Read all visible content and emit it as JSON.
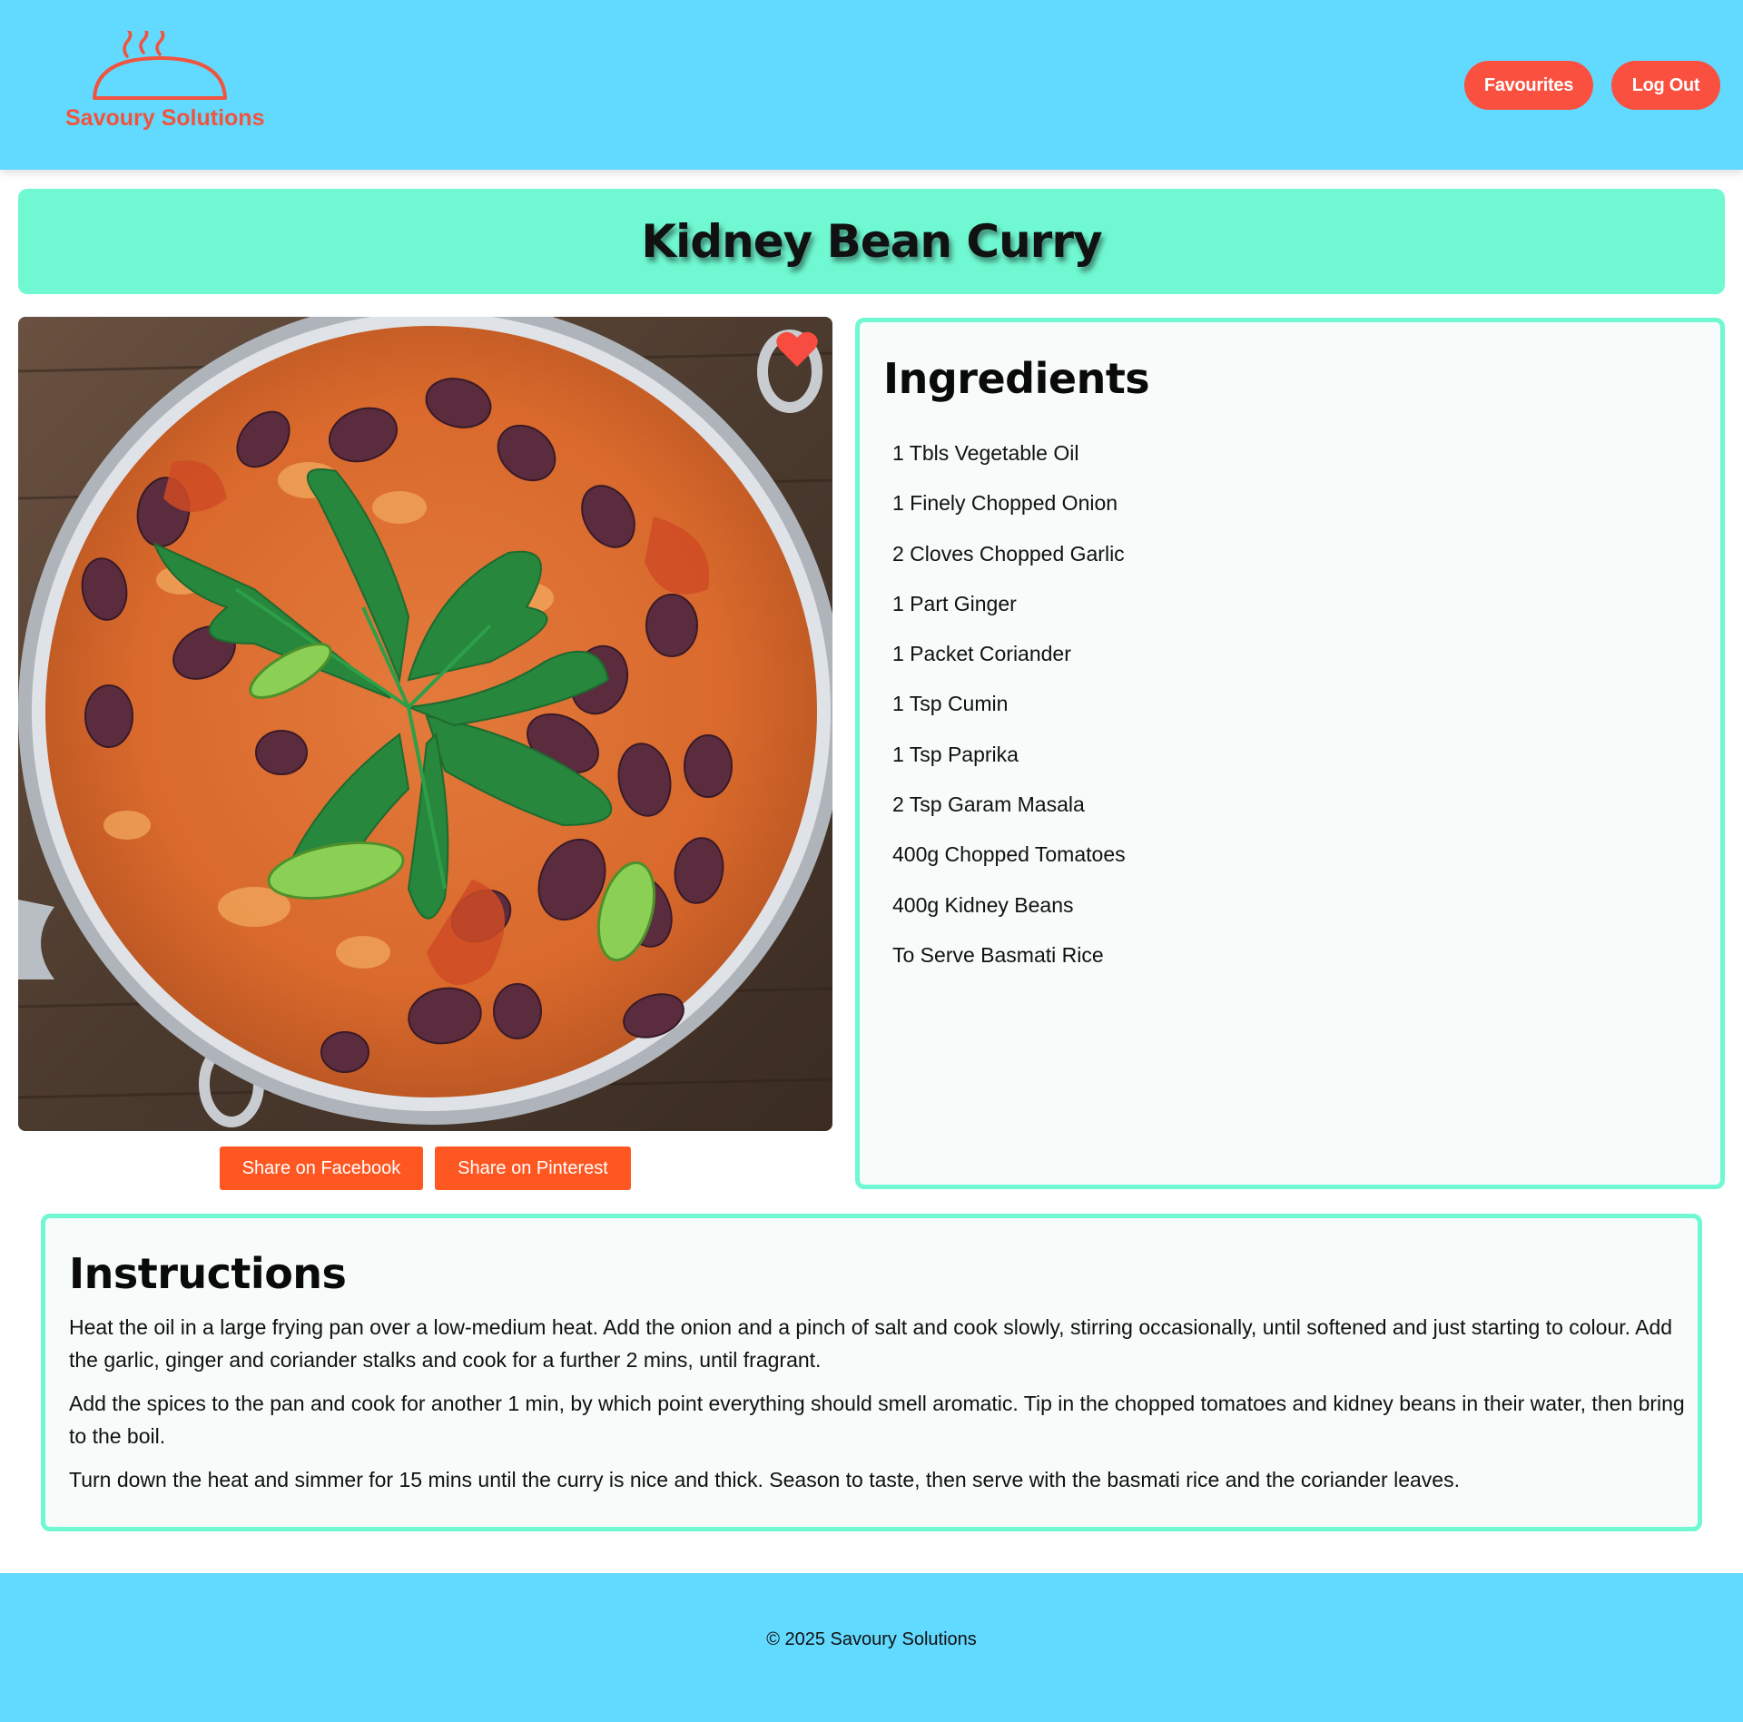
{
  "header": {
    "logo_text": "Savoury Solutions",
    "logo_icon": "serving-cloche-icon",
    "favourites_label": "Favourites",
    "logout_label": "Log Out"
  },
  "recipe": {
    "title": "Kidney Bean Curry",
    "image_alt": "Kidney Bean Curry",
    "favourite_icon": "heart-icon",
    "favourited": true
  },
  "share": {
    "facebook_label": "Share on Facebook",
    "pinterest_label": "Share on Pinterest"
  },
  "ingredients": {
    "heading": "Ingredients",
    "items": [
      "1 Tbls Vegetable Oil",
      "1 Finely Chopped Onion",
      "2 Cloves Chopped Garlic",
      "1 Part Ginger",
      "1 Packet Coriander",
      "1 Tsp Cumin",
      "1 Tsp Paprika",
      "2 Tsp Garam Masala",
      "400g Chopped Tomatoes",
      "400g Kidney Beans",
      "To Serve Basmati Rice"
    ]
  },
  "instructions": {
    "heading": "Instructions",
    "steps": [
      "Heat the oil in a large frying pan over a low-medium heat. Add the onion and a pinch of salt and cook slowly, stirring occasionally, until softened and just starting to colour. Add the garlic, ginger and coriander stalks and cook for a further 2 mins, until fragrant.",
      "Add the spices to the pan and cook for another 1 min, by which point everything should smell aromatic. Tip in the chopped tomatoes and kidney beans in their water, then bring to the boil.",
      "Turn down the heat and simmer for 15 mins until the curry is nice and thick. Season to taste, then serve with the basmati rice and the coriander leaves."
    ]
  },
  "footer": {
    "copyright": "© 2025 Savoury Solutions"
  },
  "colors": {
    "header_bg": "#62d9ff",
    "title_bg": "#6ff8d1",
    "accent": "#fa5040",
    "share_button": "#ff5722"
  }
}
